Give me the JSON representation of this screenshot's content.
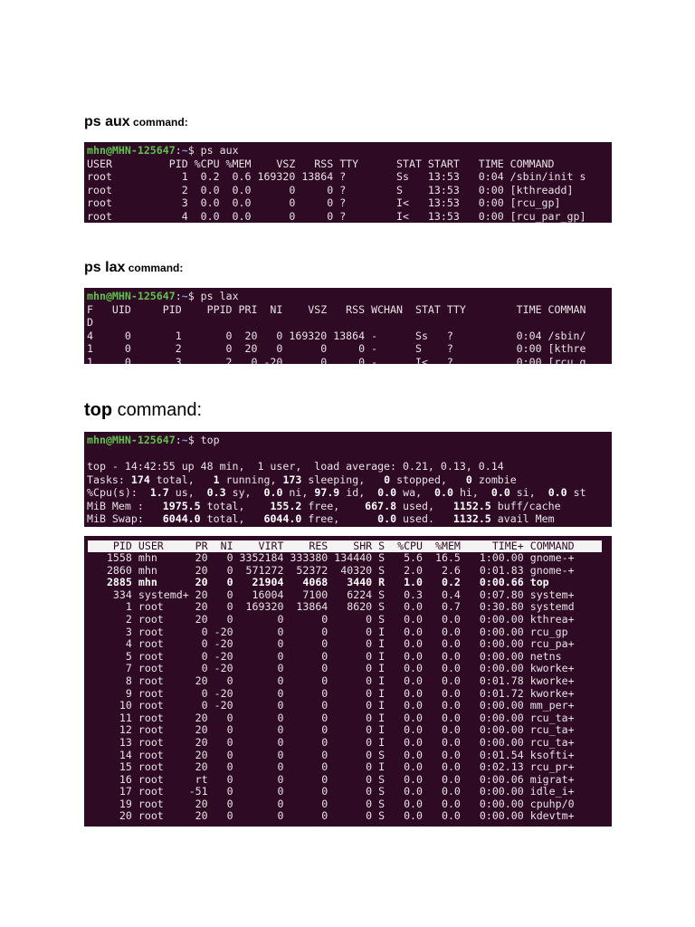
{
  "sections": {
    "aux": {
      "cmd": "ps aux",
      "rest": " command:"
    },
    "lax": {
      "cmd": "ps lax",
      "rest": " command:"
    },
    "top": {
      "cmd": "top",
      "rest": " command:"
    }
  },
  "prompt": {
    "user": "mhn@MHN-125647",
    "sep": ":",
    "path": "~",
    "dollar": "$ "
  },
  "ps_aux": {
    "command": "ps aux",
    "lines": [
      "USER         PID %CPU %MEM    VSZ   RSS TTY      STAT START   TIME COMMAND",
      "root           1  0.2  0.6 169320 13864 ?        Ss   13:53   0:04 /sbin/init s",
      "root           2  0.0  0.0      0     0 ?        S    13:53   0:00 [kthreadd]",
      "root           3  0.0  0.0      0     0 ?        I<   13:53   0:00 [rcu_gp]",
      "root           4  0.0  0.0      0     0 ?        I<   13:53   0:00 [rcu_par_gp]"
    ]
  },
  "ps_lax": {
    "command": "ps lax",
    "lines": [
      "F   UID     PID    PPID PRI  NI    VSZ   RSS WCHAN  STAT TTY        TIME COMMAN",
      "D",
      "4     0       1       0  20   0 169320 13864 -      Ss   ?          0:04 /sbin/",
      "1     0       2       0  20   0      0     0 -      S    ?          0:00 [kthre",
      "1     0       3       2   0 -20      0     0 -      I<   ?          0:00 [rcu_g"
    ]
  },
  "top_header": {
    "command": "top",
    "lines": [
      [
        {
          "t": "top - 14:42:55 up 48 min,  1 user,  load average: 0.21, 0.13, 0.14"
        }
      ],
      [
        {
          "t": "Tasks: "
        },
        {
          "t": "174",
          "b": true
        },
        {
          "t": " total,   "
        },
        {
          "t": "1",
          "b": true
        },
        {
          "t": " running, "
        },
        {
          "t": "173",
          "b": true
        },
        {
          "t": " sleeping,   "
        },
        {
          "t": "0",
          "b": true
        },
        {
          "t": " stopped,   "
        },
        {
          "t": "0",
          "b": true
        },
        {
          "t": " zombie"
        }
      ],
      [
        {
          "t": "%Cpu(s):  "
        },
        {
          "t": "1.7",
          "b": true
        },
        {
          "t": " us,  "
        },
        {
          "t": "0.3",
          "b": true
        },
        {
          "t": " sy,  "
        },
        {
          "t": "0.0",
          "b": true
        },
        {
          "t": " ni, "
        },
        {
          "t": "97.9",
          "b": true
        },
        {
          "t": " id,  "
        },
        {
          "t": "0.0",
          "b": true
        },
        {
          "t": " wa,  "
        },
        {
          "t": "0.0",
          "b": true
        },
        {
          "t": " hi,  "
        },
        {
          "t": "0.0",
          "b": true
        },
        {
          "t": " si,  "
        },
        {
          "t": "0.0",
          "b": true
        },
        {
          "t": " st"
        }
      ],
      [
        {
          "t": "MiB Mem :   "
        },
        {
          "t": "1975.5",
          "b": true
        },
        {
          "t": " total,    "
        },
        {
          "t": "155.2",
          "b": true
        },
        {
          "t": " free,    "
        },
        {
          "t": "667.8",
          "b": true
        },
        {
          "t": " used,   "
        },
        {
          "t": "1152.5",
          "b": true
        },
        {
          "t": " buff/cache"
        }
      ],
      [
        {
          "t": "MiB Swap:   "
        },
        {
          "t": "6044.0",
          "b": true
        },
        {
          "t": " total,   "
        },
        {
          "t": "6044.0",
          "b": true
        },
        {
          "t": " free,      "
        },
        {
          "t": "0.0",
          "b": true
        },
        {
          "t": " used.   "
        },
        {
          "t": "1132.5",
          "b": true
        },
        {
          "t": " avail Mem"
        }
      ]
    ]
  },
  "top_table": {
    "columns": [
      "PID",
      "USER",
      "PR",
      "NI",
      "VIRT",
      "RES",
      "SHR",
      "S",
      "%CPU",
      "%MEM",
      "TIME+",
      "COMMAND"
    ],
    "rows": [
      [
        "1558",
        "mhn",
        "20",
        "0",
        "3352184",
        "333380",
        "134440",
        "S",
        "5.6",
        "16.5",
        "1:00.00",
        "gnome-+"
      ],
      [
        "2860",
        "mhn",
        "20",
        "0",
        "571272",
        "52372",
        "40320",
        "S",
        "2.0",
        "2.6",
        "0:01.83",
        "gnome-+"
      ],
      [
        "2885",
        "mhn",
        "20",
        "0",
        "21904",
        "4068",
        "3440",
        "R",
        "1.0",
        "0.2",
        "0:00.66",
        "top"
      ],
      [
        "334",
        "systemd+",
        "20",
        "0",
        "16004",
        "7100",
        "6224",
        "S",
        "0.3",
        "0.4",
        "0:07.80",
        "system+"
      ],
      [
        "1",
        "root",
        "20",
        "0",
        "169320",
        "13864",
        "8620",
        "S",
        "0.0",
        "0.7",
        "0:30.80",
        "systemd"
      ],
      [
        "2",
        "root",
        "20",
        "0",
        "0",
        "0",
        "0",
        "S",
        "0.0",
        "0.0",
        "0:00.00",
        "kthrea+"
      ],
      [
        "3",
        "root",
        "0",
        "-20",
        "0",
        "0",
        "0",
        "I",
        "0.0",
        "0.0",
        "0:00.00",
        "rcu_gp"
      ],
      [
        "4",
        "root",
        "0",
        "-20",
        "0",
        "0",
        "0",
        "I",
        "0.0",
        "0.0",
        "0:00.00",
        "rcu_pa+"
      ],
      [
        "5",
        "root",
        "0",
        "-20",
        "0",
        "0",
        "0",
        "I",
        "0.0",
        "0.0",
        "0:00.00",
        "netns"
      ],
      [
        "7",
        "root",
        "0",
        "-20",
        "0",
        "0",
        "0",
        "I",
        "0.0",
        "0.0",
        "0:00.00",
        "kworke+"
      ],
      [
        "8",
        "root",
        "20",
        "0",
        "0",
        "0",
        "0",
        "I",
        "0.0",
        "0.0",
        "0:01.78",
        "kworke+"
      ],
      [
        "9",
        "root",
        "0",
        "-20",
        "0",
        "0",
        "0",
        "I",
        "0.0",
        "0.0",
        "0:01.72",
        "kworke+"
      ],
      [
        "10",
        "root",
        "0",
        "-20",
        "0",
        "0",
        "0",
        "I",
        "0.0",
        "0.0",
        "0:00.00",
        "mm_per+"
      ],
      [
        "11",
        "root",
        "20",
        "0",
        "0",
        "0",
        "0",
        "I",
        "0.0",
        "0.0",
        "0:00.00",
        "rcu_ta+"
      ],
      [
        "12",
        "root",
        "20",
        "0",
        "0",
        "0",
        "0",
        "I",
        "0.0",
        "0.0",
        "0:00.00",
        "rcu_ta+"
      ],
      [
        "13",
        "root",
        "20",
        "0",
        "0",
        "0",
        "0",
        "I",
        "0.0",
        "0.0",
        "0:00.00",
        "rcu_ta+"
      ],
      [
        "14",
        "root",
        "20",
        "0",
        "0",
        "0",
        "0",
        "S",
        "0.0",
        "0.0",
        "0:01.54",
        "ksofti+"
      ],
      [
        "15",
        "root",
        "20",
        "0",
        "0",
        "0",
        "0",
        "I",
        "0.0",
        "0.0",
        "0:02.13",
        "rcu_pr+"
      ],
      [
        "16",
        "root",
        "rt",
        "0",
        "0",
        "0",
        "0",
        "S",
        "0.0",
        "0.0",
        "0:00.06",
        "migrat+"
      ],
      [
        "17",
        "root",
        "-51",
        "0",
        "0",
        "0",
        "0",
        "S",
        "0.0",
        "0.0",
        "0:00.00",
        "idle_i+"
      ],
      [
        "19",
        "root",
        "20",
        "0",
        "0",
        "0",
        "0",
        "S",
        "0.0",
        "0.0",
        "0:00.00",
        "cpuhp/0"
      ],
      [
        "20",
        "root",
        "20",
        "0",
        "0",
        "0",
        "0",
        "S",
        "0.0",
        "0.0",
        "0:00.00",
        "kdevtm+"
      ]
    ],
    "bold_row_pid": "2885"
  }
}
